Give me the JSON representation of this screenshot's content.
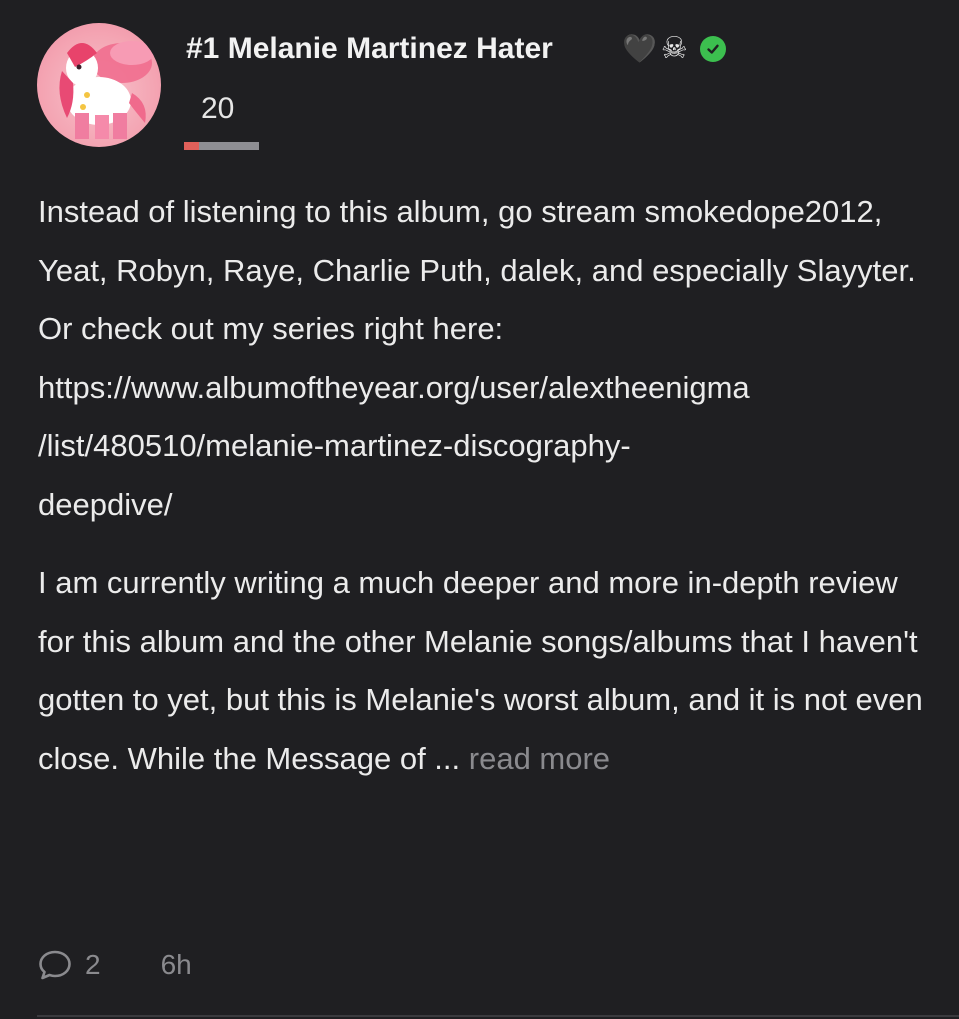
{
  "review": {
    "author": {
      "name": "#1 Melanie Martinez Hater",
      "badge_emojis": [
        "🖤",
        "☠"
      ],
      "verified": true
    },
    "score": "20",
    "score_fraction": 0.2,
    "body": {
      "paragraph1_text": "Instead of listening to this album, go stream smokedope2012, Yeat, Robyn, Raye, Charlie Puth, dalek, and especially Slayyter. Or check out my series right here:",
      "url_line1": "https://www.albumoftheyear.org/user/alextheenigma",
      "url_line2": "/list/480510/melanie-martinez-discography-",
      "url_line3": "deepdive/",
      "paragraph2_text": "I am currently writing a much deeper and more in-depth review for this album and the other Melanie songs/albums that I haven't gotten to yet, but this is Melanie's worst album, and it is not even close. While the Message of ...",
      "read_more_label": "read more"
    },
    "footer": {
      "comment_count": "2",
      "timestamp": "6h"
    }
  },
  "colors": {
    "background": "#1f1f22",
    "text": "#ebebeb",
    "muted": "#8a8a8e",
    "score_bar_fill": "#e0605a",
    "score_bar_track": "#8e8e93",
    "verified": "#3cbf4f"
  },
  "icons": {
    "verified": "check-circle-icon",
    "comment": "speech-bubble-icon"
  }
}
